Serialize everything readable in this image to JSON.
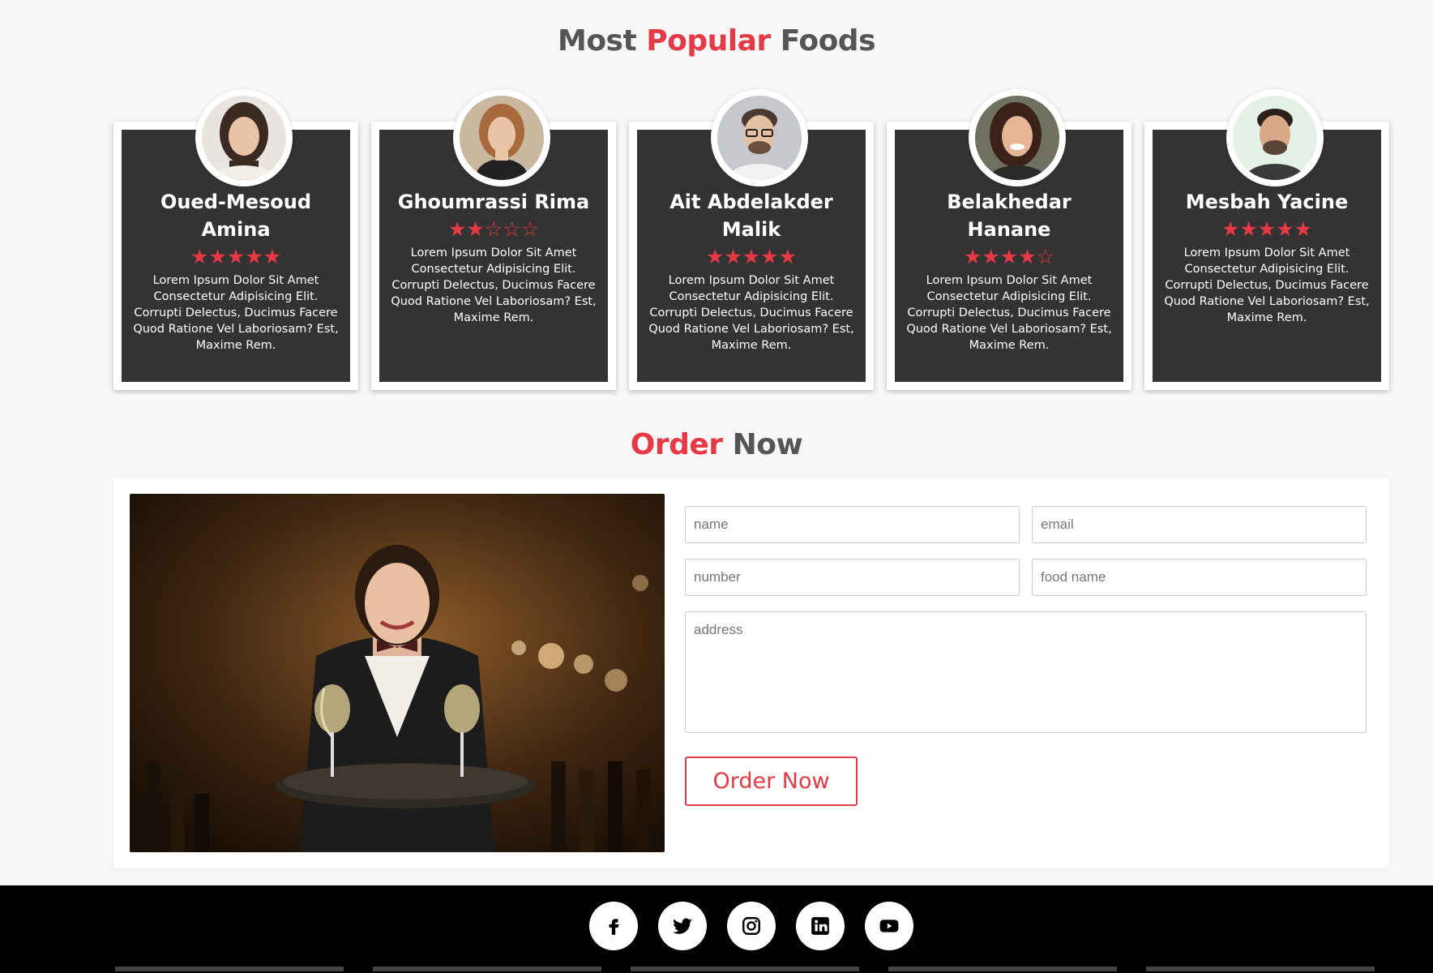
{
  "popular": {
    "title_part1": "Most",
    "title_accent": "Popular",
    "title_part2": "Foods",
    "cards": [
      {
        "name": "Oued-Mesoud Amina",
        "rating": 5,
        "stars": "★★★★★",
        "text": "Lorem Ipsum Dolor Sit Amet Consectetur Adipisicing Elit. Corrupti Delectus, Ducimus Facere Quod Ratione Vel Laboriosam? Est, Maxime Rem."
      },
      {
        "name": "Ghoumrassi Rima",
        "rating": 2,
        "stars": "★★☆☆☆",
        "text": "Lorem Ipsum Dolor Sit Amet Consectetur Adipisicing Elit. Corrupti Delectus, Ducimus Facere Quod Ratione Vel Laboriosam? Est, Maxime Rem."
      },
      {
        "name": "Ait Abdelakder Malik",
        "rating": 5,
        "stars": "★★★★★",
        "text": "Lorem Ipsum Dolor Sit Amet Consectetur Adipisicing Elit. Corrupti Delectus, Ducimus Facere Quod Ratione Vel Laboriosam? Est, Maxime Rem."
      },
      {
        "name": "Belakhedar Hanane",
        "rating": 4,
        "stars": "★★★★☆",
        "text": "Lorem Ipsum Dolor Sit Amet Consectetur Adipisicing Elit. Corrupti Delectus, Ducimus Facere Quod Ratione Vel Laboriosam? Est, Maxime Rem."
      },
      {
        "name": "Mesbah Yacine",
        "rating": 5,
        "stars": "★★★★★",
        "text": "Lorem Ipsum Dolor Sit Amet Consectetur Adipisicing Elit. Corrupti Delectus, Ducimus Facere Quod Ratione Vel Laboriosam? Est, Maxime Rem."
      }
    ]
  },
  "order": {
    "title_accent": "Order",
    "title_part2": "Now",
    "fields": {
      "name": "name",
      "email": "email",
      "number": "number",
      "food_name": "food name",
      "address": "address"
    },
    "button_label": "Order Now"
  },
  "footer": {
    "socials": [
      "facebook-icon",
      "twitter-icon",
      "instagram-icon",
      "linkedin-icon",
      "youtube-icon"
    ]
  },
  "colors": {
    "accent": "#e63946",
    "card_bg": "#333333",
    "footer_bg": "#000000"
  }
}
